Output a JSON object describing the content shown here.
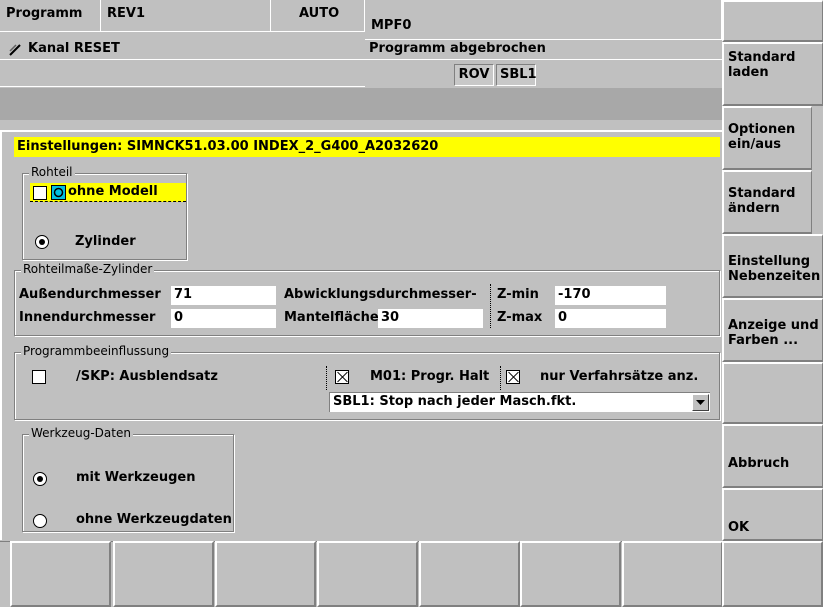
{
  "header": {
    "mode_label": "Programm",
    "rev": "REV1",
    "auto": "AUTO",
    "program": "MPF0",
    "channel": "Kanal RESET",
    "status": "Programm abgebrochen",
    "rov": "ROV",
    "sbl": "SBL1"
  },
  "softkeys": {
    "standard_laden": "Standard laden",
    "optionen": "Optionen ein/aus",
    "standard_aendern": "Standard ändern",
    "einstellung": "Einstellung Nebenzeiten",
    "anzeige": "Anzeige und Farben ...",
    "abbruch": "Abbruch",
    "ok": "OK"
  },
  "dialog": {
    "title": "Einstellungen:  SIMNCK51.03.00   INDEX_2_G400_A2032620",
    "rohteil": {
      "legend": "Rohteil",
      "model": "ohne Modell",
      "zylinder": "Zylinder"
    },
    "masse": {
      "legend": "Rohteilmaße-Zylinder",
      "aussen_label": "Außendurchmesser",
      "aussen_value": "71",
      "innen_label": "Innendurchmesser",
      "innen_value": "0",
      "abw_label": "Abwicklungsdurchmesser-",
      "mantel_label": "Mantelfläche",
      "mantel_value": "30",
      "zmin_label": "Z-min",
      "zmin_value": "-170",
      "zmax_label": "Z-max",
      "zmax_value": "0"
    },
    "programm": {
      "legend": "Programmbeeinflussung",
      "skp": "/SKP: Ausblendsatz",
      "m01": "M01: Progr. Halt",
      "nur": "nur Verfahrsätze anz.",
      "sbl_select": "SBL1: Stop nach jeder Masch.fkt."
    },
    "werkzeug": {
      "legend": "Werkzeug-Daten",
      "mit": "mit Werkzeugen",
      "ohne": "ohne Werkzeugdaten"
    }
  }
}
